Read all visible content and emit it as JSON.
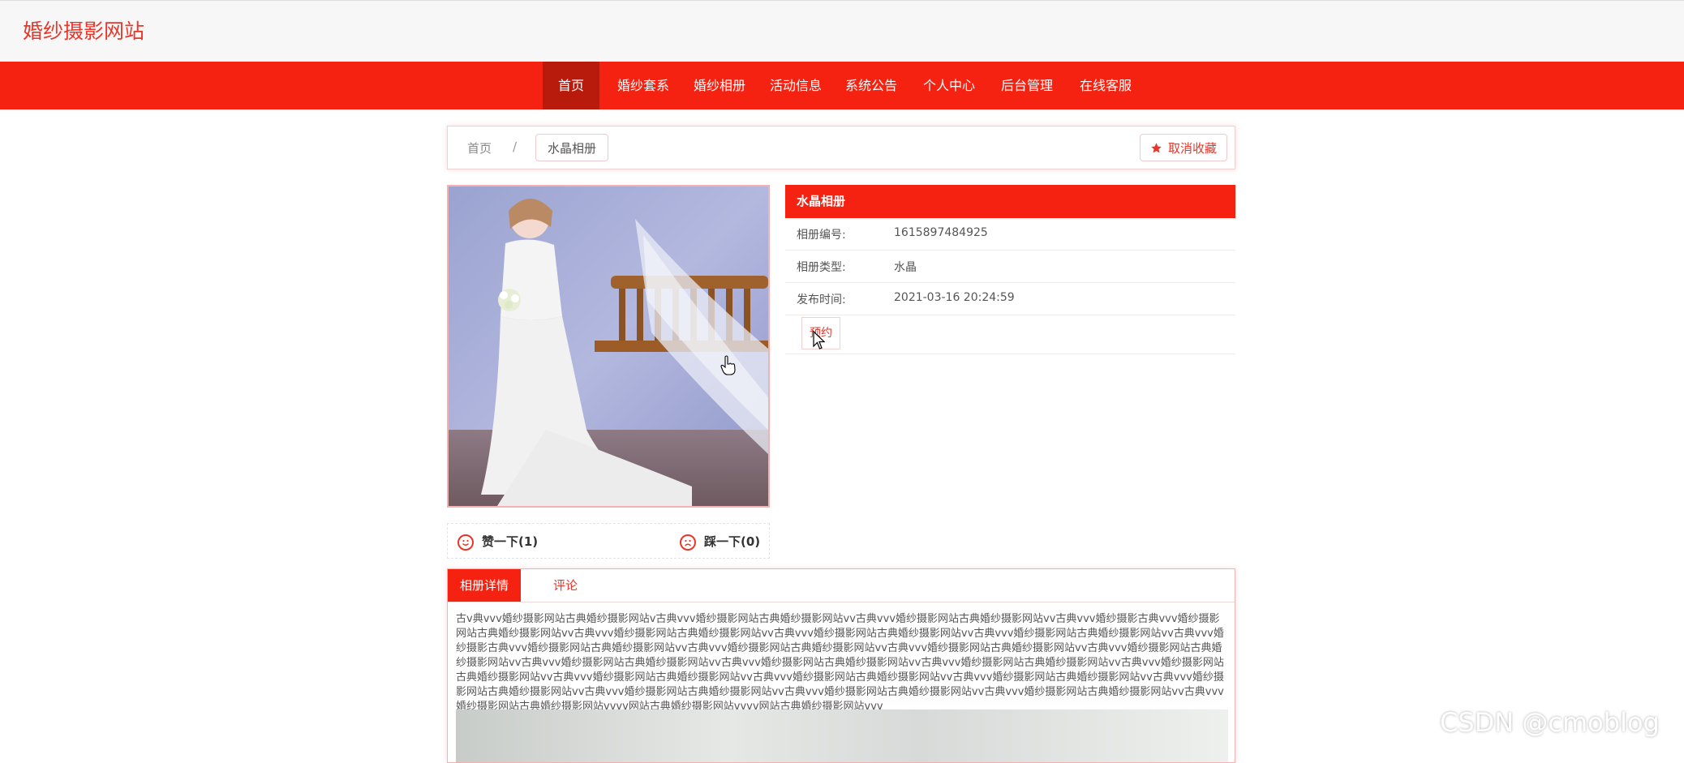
{
  "site": {
    "title": "婚纱摄影网站"
  },
  "nav": [
    {
      "label": "首页",
      "active": true
    },
    {
      "label": "婚纱套系"
    },
    {
      "label": "婚纱相册"
    },
    {
      "label": "活动信息"
    },
    {
      "label": "系统公告"
    },
    {
      "label": "个人中心"
    },
    {
      "label": "后台管理"
    },
    {
      "label": "在线客服"
    }
  ],
  "breadcrumb": {
    "home": "首页",
    "separator": "/",
    "current": "水晶相册"
  },
  "favorite_button": {
    "label": "取消收藏",
    "icon": "star-icon"
  },
  "album": {
    "title": "水晶相册",
    "fields": [
      {
        "label": "相册编号:",
        "value": "1615897484925"
      },
      {
        "label": "相册类型:",
        "value": "水晶"
      },
      {
        "label": "发布时间:",
        "value": "2021-03-16 20:24:59"
      }
    ],
    "book_button": "预约"
  },
  "votes": {
    "like": "赞一下(1)",
    "dislike": "踩一下(0)"
  },
  "tabs": [
    {
      "label": "相册详情",
      "active": true
    },
    {
      "label": "评论"
    }
  ],
  "detail_text": "古v典vvv婚纱摄影网站古典婚纱摄影网站v古典vvv婚纱摄影网站古典婚纱摄影网站vv古典vvv婚纱摄影网站古典婚纱摄影网站vv古典vvv婚纱摄影古典vvv婚纱摄影网站古典婚纱摄影网站vv古典vvv婚纱摄影网站古典婚纱摄影网站vv古典vvv婚纱摄影网站古典婚纱摄影网站vv古典vvv婚纱摄影网站古典婚纱摄影网站vv古典vvv婚纱摄影古典vvv婚纱摄影网站古典婚纱摄影网站vv古典vvv婚纱摄影网站古典婚纱摄影网站vv古典vvv婚纱摄影网站古典婚纱摄影网站vv古典vvv婚纱摄影网站古典婚纱摄影网站vv古典vvv婚纱摄影网站古典婚纱摄影网站vv古典vvv婚纱摄影网站古典婚纱摄影网站vv古典vvv婚纱摄影网站古典婚纱摄影网站vv古典vvv婚纱摄影网站古典婚纱摄影网站vv古典vvv婚纱摄影网站古典婚纱摄影网站vv古典vvv婚纱摄影网站古典婚纱摄影网站vv古典vvv婚纱摄影网站古典婚纱摄影网站vv古典vvv婚纱摄影网站古典婚纱摄影网站vv古典vvv婚纱摄影网站古典婚纱摄影网站vv古典vvv婚纱摄影网站古典婚纱摄影网站vv古典vvv婚纱摄影网站古典婚纱摄影网站vv古典vvv婚纱摄影网站古典婚纱摄影网站vvvv网站古典婚纱摄影网站vvvv网站古典婚纱摄影网站vvv",
  "watermark": "CSDN @cmoblog",
  "colors": {
    "accent": "#f52211",
    "accent_dark": "#b81a0c",
    "title_red": "#e8362a"
  }
}
